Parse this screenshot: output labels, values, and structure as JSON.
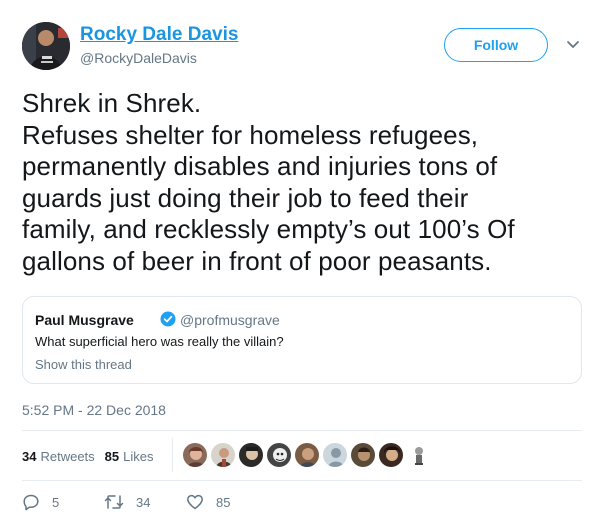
{
  "author": {
    "name": "Rocky Dale Davis",
    "handle": "@RockyDaleDavis"
  },
  "follow_label": "Follow",
  "tweet": {
    "lines": [
      "Shrek in Shrek.",
      "Refuses shelter for homeless refugees,",
      "permanently disables and injuries tons of",
      "guards just doing their job to feed their",
      "family, and recklessly empty’s out 100’s Of",
      "gallons of beer in front of poor peasants."
    ],
    "timestamp": "5:52 PM - 22 Dec 2018"
  },
  "quoted": {
    "name": "Paul Musgrave",
    "handle": "@profmusgrave",
    "text": "What superficial hero was really the villain?",
    "show_thread": "Show this thread"
  },
  "stats": {
    "retweets_count": "34",
    "retweets_label": "Retweets",
    "likes_count": "85",
    "likes_label": "Likes"
  },
  "actions": {
    "replies": "5",
    "retweets": "34",
    "likes": "85"
  },
  "colors": {
    "accent": "#1da1f2",
    "name_link": "#1b95e0",
    "secondary_text": "#657786"
  }
}
